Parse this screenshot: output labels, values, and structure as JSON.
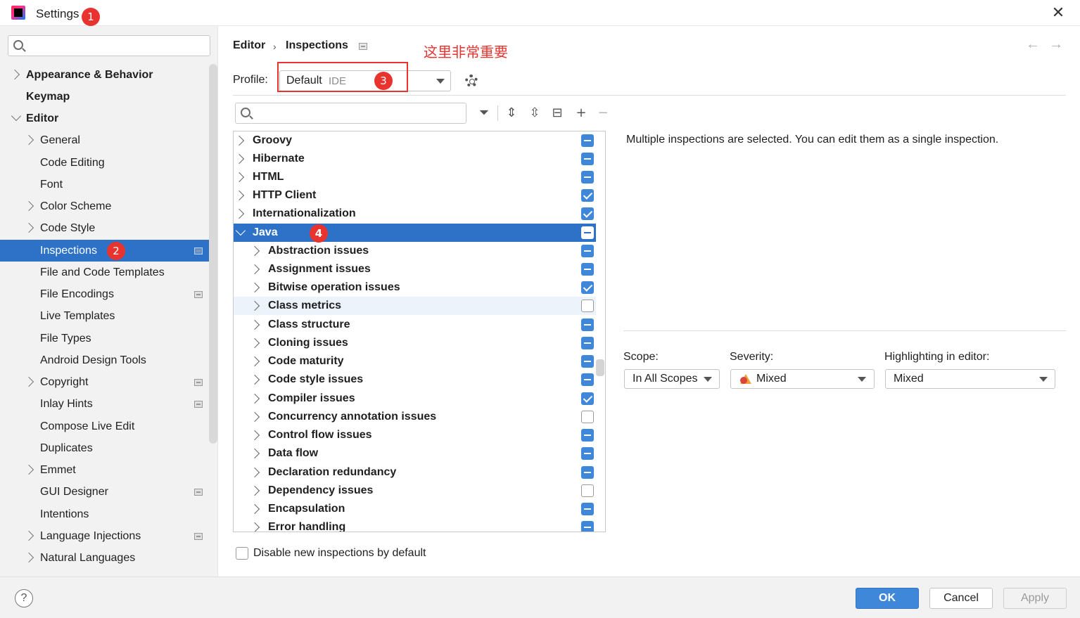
{
  "window": {
    "title": "Settings",
    "close_glyph": "✕"
  },
  "badges": {
    "b1": "1",
    "b2": "2",
    "b3": "3",
    "b4": "4"
  },
  "annotation": "这里非常重要",
  "sidebar": {
    "items": [
      {
        "label": "Appearance & Behavior"
      },
      {
        "label": "Keymap"
      },
      {
        "label": "Editor"
      },
      {
        "label": "General"
      },
      {
        "label": "Code Editing"
      },
      {
        "label": "Font"
      },
      {
        "label": "Color Scheme"
      },
      {
        "label": "Code Style"
      },
      {
        "label": "Inspections"
      },
      {
        "label": "File and Code Templates"
      },
      {
        "label": "File Encodings"
      },
      {
        "label": "Live Templates"
      },
      {
        "label": "File Types"
      },
      {
        "label": "Android Design Tools"
      },
      {
        "label": "Copyright"
      },
      {
        "label": "Inlay Hints"
      },
      {
        "label": "Compose Live Edit"
      },
      {
        "label": "Duplicates"
      },
      {
        "label": "Emmet"
      },
      {
        "label": "GUI Designer"
      },
      {
        "label": "Intentions"
      },
      {
        "label": "Language Injections"
      },
      {
        "label": "Natural Languages"
      }
    ]
  },
  "breadcrumb": {
    "parent": "Editor",
    "sep": "›",
    "current": "Inspections"
  },
  "nav": {
    "back": "←",
    "forward": "→"
  },
  "profile": {
    "label": "Profile:",
    "value": "Default",
    "scope": "IDE"
  },
  "toolbar": {
    "filter": "⏷",
    "expand": "⇕",
    "collapse": "⇳",
    "reset": "⊟",
    "add": "+",
    "remove": "−"
  },
  "tree": {
    "rows": [
      {
        "label": "Groovy",
        "state": "mixed"
      },
      {
        "label": "Hibernate",
        "state": "mixed"
      },
      {
        "label": "HTML",
        "state": "mixed"
      },
      {
        "label": "HTTP Client",
        "state": "checked"
      },
      {
        "label": "Internationalization",
        "state": "checked"
      },
      {
        "label": "Java",
        "state": "mixed"
      },
      {
        "label": "Abstraction issues",
        "state": "mixed"
      },
      {
        "label": "Assignment issues",
        "state": "mixed"
      },
      {
        "label": "Bitwise operation issues",
        "state": "checked"
      },
      {
        "label": "Class metrics",
        "state": "unchecked"
      },
      {
        "label": "Class structure",
        "state": "mixed"
      },
      {
        "label": "Cloning issues",
        "state": "mixed"
      },
      {
        "label": "Code maturity",
        "state": "mixed"
      },
      {
        "label": "Code style issues",
        "state": "mixed"
      },
      {
        "label": "Compiler issues",
        "state": "checked"
      },
      {
        "label": "Concurrency annotation issues",
        "state": "unchecked"
      },
      {
        "label": "Control flow issues",
        "state": "mixed"
      },
      {
        "label": "Data flow",
        "state": "mixed"
      },
      {
        "label": "Declaration redundancy",
        "state": "mixed"
      },
      {
        "label": "Dependency issues",
        "state": "unchecked"
      },
      {
        "label": "Encapsulation",
        "state": "mixed"
      },
      {
        "label": "Error handling",
        "state": "mixed"
      }
    ]
  },
  "disable_new": {
    "label": "Disable new inspections by default",
    "checked": false
  },
  "details": {
    "description": "Multiple inspections are selected. You can edit them as a single inspection.",
    "scope_label": "Scope:",
    "scope_value": "In All Scopes",
    "severity_label": "Severity:",
    "severity_value": "Mixed",
    "highlight_label": "Highlighting in editor:",
    "highlight_value": "Mixed"
  },
  "buttons": {
    "help": "?",
    "ok": "OK",
    "cancel": "Cancel",
    "apply": "Apply"
  }
}
